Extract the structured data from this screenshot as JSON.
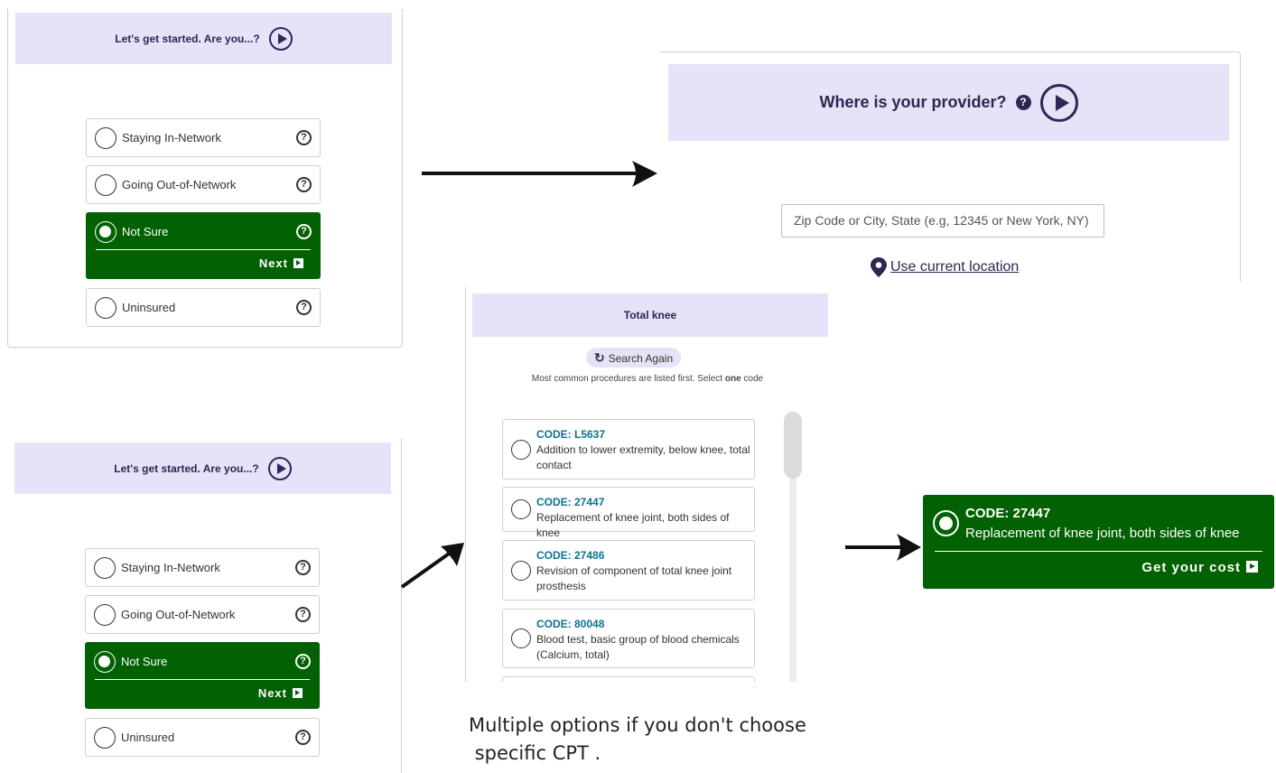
{
  "step1": {
    "banner_text": "Let's get started. Are you...?",
    "options": [
      {
        "label": "Staying In-Network",
        "help": "?"
      },
      {
        "label": "Going Out-of-Network",
        "help": "?"
      },
      {
        "label": "Not Sure",
        "help": "?",
        "selected": true
      },
      {
        "label": "Uninsured",
        "help": "?"
      }
    ],
    "next_label": "Next"
  },
  "provider": {
    "title": "Where is your provider?",
    "help": "?",
    "zip_placeholder": "Zip Code or City, State (e.g, 12345 or New York, NY)",
    "location_link": "Use current location"
  },
  "codes": {
    "banner_text": "Total knee",
    "search_again": "Search Again",
    "hint_pre": "Most common procedures are listed first. Select ",
    "hint_bold": "one",
    "hint_post": " code",
    "items": [
      {
        "code": "CODE: L5637",
        "desc": "Addition to lower extremity, below knee, total contact"
      },
      {
        "code": "CODE: 27447",
        "desc": "Replacement of knee joint, both sides of knee"
      },
      {
        "code": "CODE: 27486",
        "desc": "Revision of component of total knee joint prosthesis"
      },
      {
        "code": "CODE: 80048",
        "desc": "Blood test, basic group of blood chemicals (Calcium, total)"
      }
    ]
  },
  "selected_code": {
    "code": "CODE: 27447",
    "desc": "Replacement of knee joint, both sides of knee",
    "cta": "Get your cost"
  },
  "caption": "Multiple options if you don't choose\n specific CPT .",
  "colors": {
    "banner_bg": "#e5e3f7",
    "selected_green": "#026102",
    "code_blue": "#0d7191",
    "navy": "#2b2752"
  },
  "icons": [
    "play-circle-icon",
    "help-circle-icon",
    "location-pin-icon",
    "refresh-icon",
    "arrow-right-icon"
  ]
}
